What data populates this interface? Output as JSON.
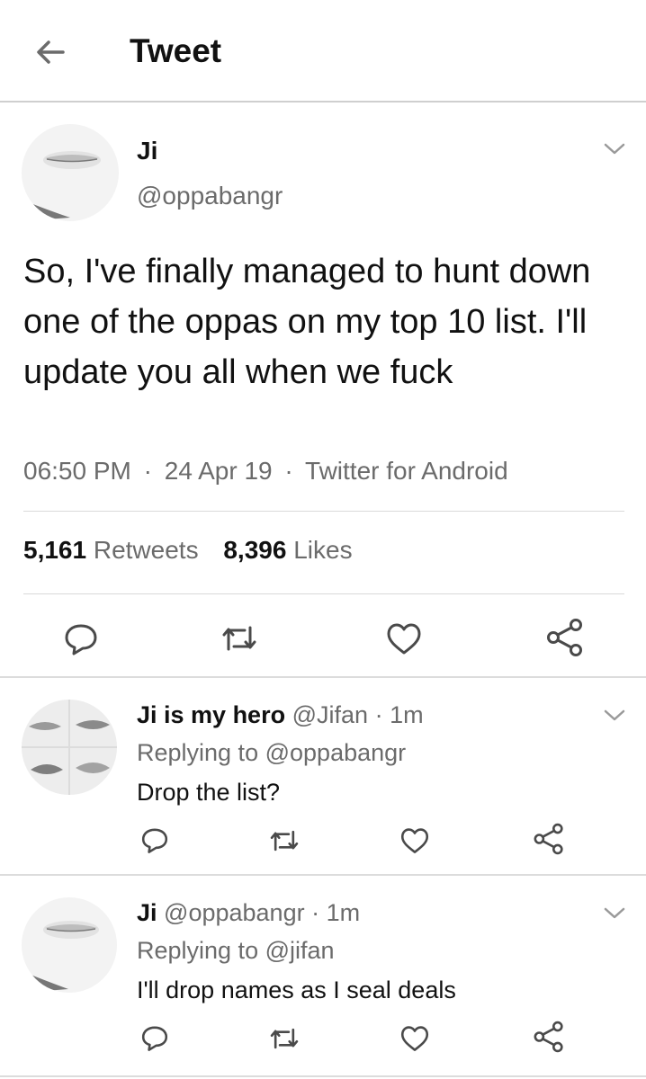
{
  "header": {
    "title": "Tweet"
  },
  "tweet": {
    "name": "Ji",
    "handle": "@oppabangr",
    "text": "So, I've finally managed to hunt down one of the oppas on my top 10 list. I'll update you all when we fuck",
    "time": "06:50 PM",
    "date": "24 Apr 19",
    "source": "Twitter for Android",
    "sep": "·",
    "retweets": {
      "count": "5,161",
      "label": "Retweets"
    },
    "likes": {
      "count": "8,396",
      "label": "Likes"
    }
  },
  "replies": [
    {
      "name": "Ji is my hero",
      "handle": "@Jifan",
      "time": "1m",
      "replying_label": "Replying to",
      "replying_to": "@oppabangr",
      "text": "Drop the list?"
    },
    {
      "name": "Ji",
      "handle": "@oppabangr",
      "time": "1m",
      "replying_label": "Replying to",
      "replying_to": "@jifan",
      "text": "I'll drop names as I seal deals"
    }
  ],
  "icons": {
    "back": "arrow-left-icon",
    "more": "chevron-down-icon",
    "reply": "comment-bubble-icon",
    "retweet": "retweet-icon",
    "like": "heart-icon",
    "share": "share-icon"
  },
  "colors": {
    "text": "#111111",
    "muted": "#6b6b6b",
    "divider": "#d9d9d9"
  }
}
